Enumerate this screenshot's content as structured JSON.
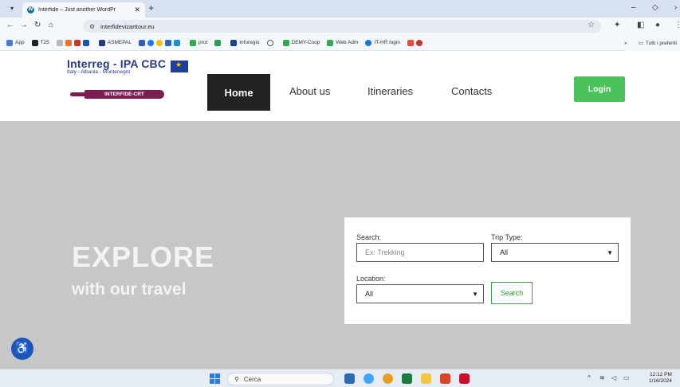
{
  "browser": {
    "tab_title": "Interfide – Just another WordPr",
    "url": "interfidevizarttour.eu",
    "bookmarks": [
      "App",
      "T25",
      "ASMEPAL",
      "prot",
      "Inforegio",
      "DEMY-Coop",
      "Web Adm",
      "IT-HR login"
    ],
    "bookmarks_more": "»",
    "bookmarks_folder": "Tutti i preferiti"
  },
  "site": {
    "logo_line1": "Interreg - IPA CBC",
    "logo_line2": "Italy - Albania - Montenegro",
    "logo_ribbon": "INTERFIDE-CRT",
    "nav": [
      "Home",
      "About us",
      "Itineraries",
      "Contacts"
    ],
    "login_label": "Login"
  },
  "hero": {
    "title": "EXPLORE",
    "subtitle": "with our travel"
  },
  "search_form": {
    "search_label": "Search:",
    "search_placeholder": "Ex: Trekking",
    "trip_type_label": "Trip Type:",
    "trip_type_value": "All",
    "location_label": "Location:",
    "location_value": "All",
    "button_label": "Search"
  },
  "taskbar": {
    "search_placeholder": "Cerca",
    "time": "12:12 PM",
    "date": "1/16/2024"
  }
}
